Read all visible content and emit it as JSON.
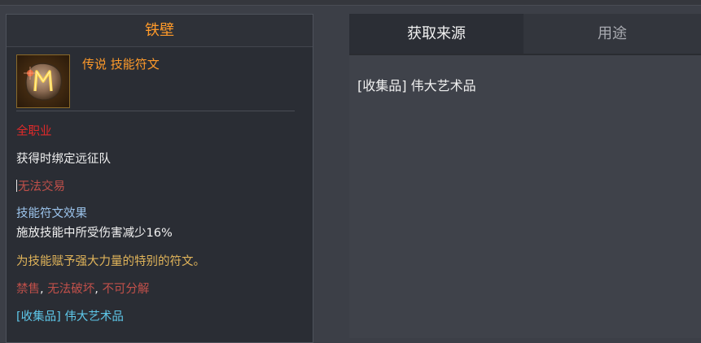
{
  "tooltip": {
    "title": "铁壁",
    "grade": "传说 技能符文",
    "icon": "rune-icon",
    "class_req": "全职业",
    "bind": "获得时绑定远征队",
    "trade": "无法交易",
    "effect_title": "技能符文效果",
    "effect_desc": "施放技能中所受伤害减少16%",
    "flavor": "为技能赋予强大力量的特别的符文。",
    "restrict_1": "禁售",
    "sep_1": ",",
    "restrict_2": "无法破坏",
    "sep_2": ",",
    "restrict_3": "不可分解",
    "source": "[收集品] 伟大艺术品"
  },
  "tabs": {
    "source_label": "获取来源",
    "usage_label": "用途"
  },
  "sources": [
    "[收集品] 伟大艺术品"
  ],
  "colors": {
    "legendary": "#ff9a2a",
    "class": "#e02a2a",
    "restricted": "#c0504a",
    "effect": "#9cc4ec",
    "flavor": "#e0b45a",
    "link": "#5ec8ea"
  }
}
